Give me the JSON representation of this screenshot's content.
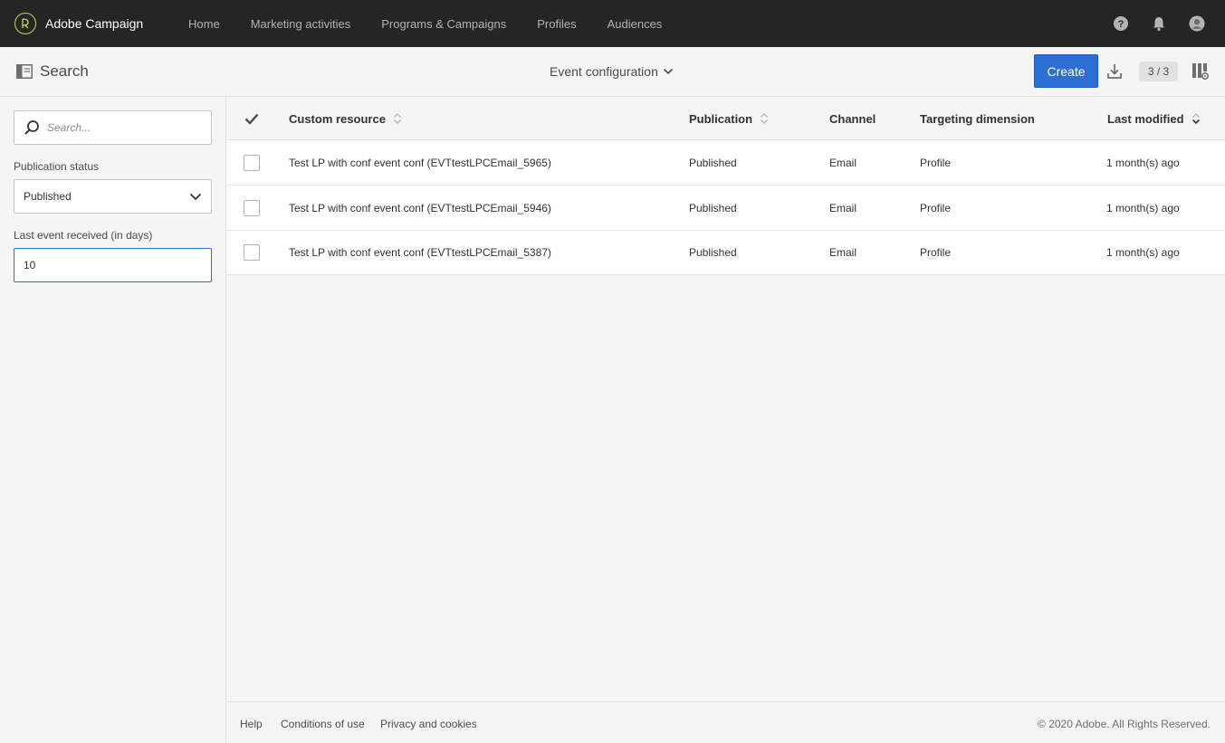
{
  "app": {
    "name": "Adobe Campaign"
  },
  "nav": {
    "items": [
      {
        "label": "Home"
      },
      {
        "label": "Marketing activities"
      },
      {
        "label": "Programs & Campaigns"
      },
      {
        "label": "Profiles"
      },
      {
        "label": "Audiences"
      }
    ]
  },
  "toolbar": {
    "search_label": "Search",
    "view_title": "Event configuration",
    "create_label": "Create",
    "count": "3 / 3"
  },
  "sidebar": {
    "search_placeholder": "Search...",
    "status_label": "Publication status",
    "status_value": "Published",
    "days_label": "Last event received (in days)",
    "days_value": "10"
  },
  "table": {
    "columns": [
      {
        "label": "Custom resource"
      },
      {
        "label": "Publication"
      },
      {
        "label": "Channel"
      },
      {
        "label": "Targeting dimension"
      },
      {
        "label": "Last modified"
      }
    ],
    "rows": [
      {
        "resource": "Test LP with conf event conf (EVTtestLPCEmail_5965)",
        "publication": "Published",
        "channel": "Email",
        "targeting": "Profile",
        "modified": "1 month(s) ago"
      },
      {
        "resource": "Test LP with conf event conf (EVTtestLPCEmail_5946)",
        "publication": "Published",
        "channel": "Email",
        "targeting": "Profile",
        "modified": "1 month(s) ago"
      },
      {
        "resource": "Test LP with conf event conf (EVTtestLPCEmail_5387)",
        "publication": "Published",
        "channel": "Email",
        "targeting": "Profile",
        "modified": "1 month(s) ago"
      }
    ]
  },
  "footer": {
    "links": [
      {
        "label": "Help"
      },
      {
        "label": "Conditions of use"
      },
      {
        "label": "Privacy and cookies"
      }
    ],
    "copyright": "© 2020 Adobe. All Rights Reserved."
  },
  "colors": {
    "topbar": "#252525",
    "accent": "#2d6ed2",
    "logo": "#c5d94d"
  }
}
